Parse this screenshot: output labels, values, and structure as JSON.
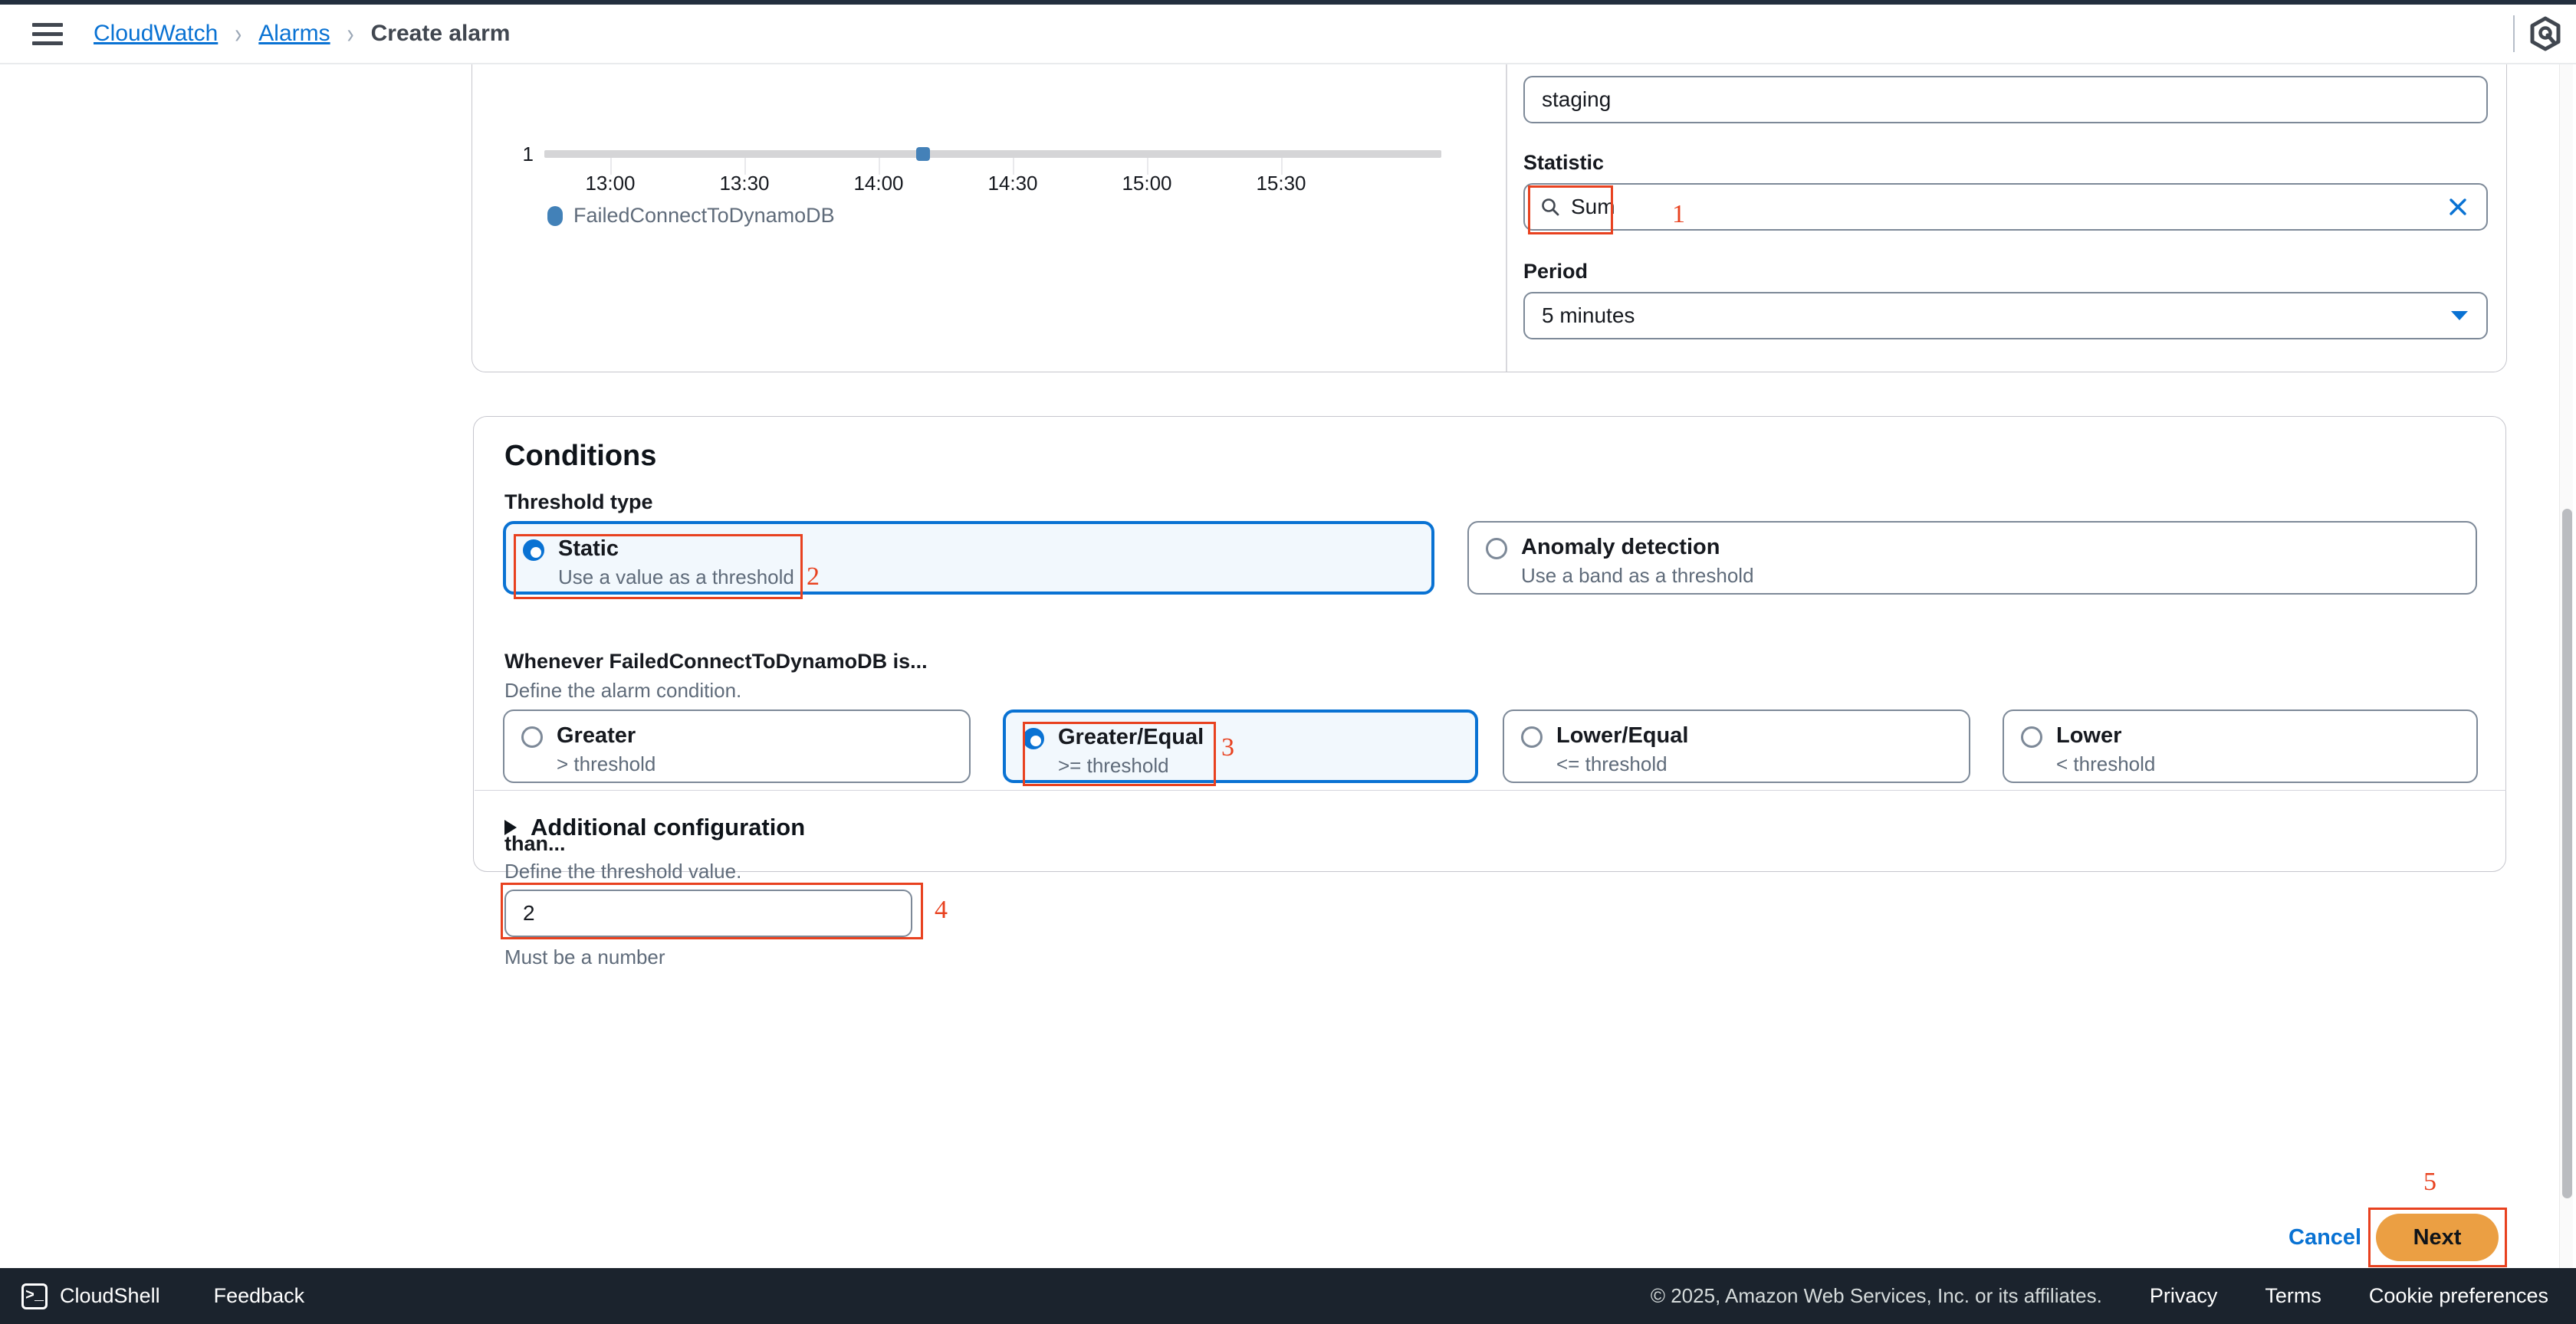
{
  "header": {
    "menu_icon": "hamburger-icon",
    "breadcrumb": {
      "items": [
        {
          "label": "CloudWatch",
          "link": true
        },
        {
          "label": "Alarms",
          "link": true
        },
        {
          "label": "Create alarm",
          "link": false
        }
      ],
      "separator": "›"
    },
    "assistant_icon": "amazon-q-hexagon-icon"
  },
  "metric_panel": {
    "chart_data": {
      "type": "line",
      "title": "",
      "xlabel": "",
      "ylabel": "",
      "x_tick_labels": [
        "13:00",
        "13:30",
        "14:00",
        "14:30",
        "15:00",
        "15:30"
      ],
      "y_tick_labels": [
        "1"
      ],
      "ylim": [
        0,
        1
      ],
      "grid": false,
      "legend_position": "bottom-left",
      "series": [
        {
          "name": "FailedConnectToDynamoDB",
          "color": "#4281b8",
          "values": [
            0,
            0,
            0,
            0,
            0,
            0
          ],
          "points": [
            {
              "x": "13:55",
              "y": 1
            }
          ]
        }
      ],
      "threshold_line": {
        "value": 1,
        "color": "#d5d5d7"
      }
    },
    "namespace_value": "staging",
    "statistic": {
      "label": "Statistic",
      "value": "Sum",
      "search_icon": "search-icon",
      "clear_icon": "close-icon"
    },
    "period": {
      "label": "Period",
      "value": "5 minutes",
      "caret_icon": "chevron-down-icon"
    }
  },
  "conditions": {
    "title": "Conditions",
    "threshold_type": {
      "label": "Threshold type",
      "options": [
        {
          "title": "Static",
          "desc": "Use a value as a threshold",
          "selected": true
        },
        {
          "title": "Anomaly detection",
          "desc": "Use a band as a threshold",
          "selected": false
        }
      ]
    },
    "comparison": {
      "label": "Whenever FailedConnectToDynamoDB is...",
      "desc": "Define the alarm condition.",
      "options": [
        {
          "title": "Greater",
          "desc": "> threshold",
          "selected": false
        },
        {
          "title": "Greater/Equal",
          "desc": ">= threshold",
          "selected": true
        },
        {
          "title": "Lower/Equal",
          "desc": "<= threshold",
          "selected": false
        },
        {
          "title": "Lower",
          "desc": "< threshold",
          "selected": false
        }
      ]
    },
    "threshold_value": {
      "label": "than...",
      "desc": "Define the threshold value.",
      "value": "2",
      "hint": "Must be a number"
    },
    "additional_configuration": {
      "label": "Additional configuration",
      "expanded": false,
      "caret_icon": "caret-right-icon"
    }
  },
  "actions": {
    "cancel_label": "Cancel",
    "next_label": "Next"
  },
  "annotations": [
    {
      "number": "1"
    },
    {
      "number": "2"
    },
    {
      "number": "3"
    },
    {
      "number": "4"
    },
    {
      "number": "5"
    }
  ],
  "footer": {
    "cloudshell_label": "CloudShell",
    "cloudshell_icon": "terminal-icon",
    "feedback_label": "Feedback",
    "copyright": "© 2025, Amazon Web Services, Inc. or its affiliates.",
    "links": [
      "Privacy",
      "Terms",
      "Cookie preferences"
    ]
  },
  "colors": {
    "accent_blue": "#0972d3",
    "annotation_red": "#e8411f",
    "next_orange": "#eb9f43",
    "series_blue": "#4281b8"
  }
}
